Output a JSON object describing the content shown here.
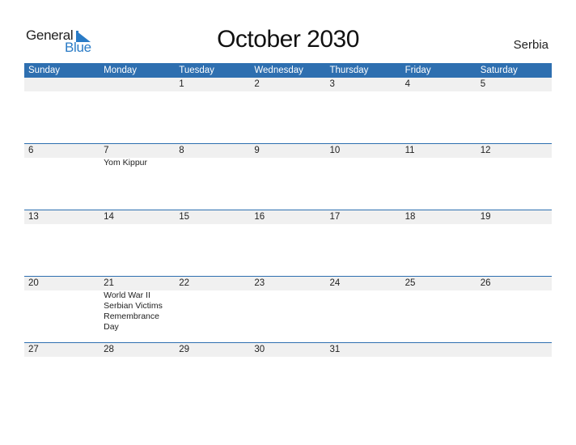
{
  "logo": {
    "word1": "General",
    "word2": "Blue",
    "icon": "blue-triangle-flag-icon"
  },
  "header": {
    "title": "October 2030",
    "country": "Serbia"
  },
  "colors": {
    "accent": "#2e6fb0",
    "logo_blue": "#2a7bc6",
    "strip": "#f0f0f0"
  },
  "days": [
    "Sunday",
    "Monday",
    "Tuesday",
    "Wednesday",
    "Thursday",
    "Friday",
    "Saturday"
  ],
  "weeks": [
    [
      {
        "day": ""
      },
      {
        "day": ""
      },
      {
        "day": "1"
      },
      {
        "day": "2"
      },
      {
        "day": "3"
      },
      {
        "day": "4"
      },
      {
        "day": "5"
      }
    ],
    [
      {
        "day": "6"
      },
      {
        "day": "7",
        "events": [
          "Yom Kippur"
        ]
      },
      {
        "day": "8"
      },
      {
        "day": "9"
      },
      {
        "day": "10"
      },
      {
        "day": "11"
      },
      {
        "day": "12"
      }
    ],
    [
      {
        "day": "13"
      },
      {
        "day": "14"
      },
      {
        "day": "15"
      },
      {
        "day": "16"
      },
      {
        "day": "17"
      },
      {
        "day": "18"
      },
      {
        "day": "19"
      }
    ],
    [
      {
        "day": "20"
      },
      {
        "day": "21",
        "events": [
          "World War II",
          "Serbian Victims",
          "Remembrance Day"
        ]
      },
      {
        "day": "22"
      },
      {
        "day": "23"
      },
      {
        "day": "24"
      },
      {
        "day": "25"
      },
      {
        "day": "26"
      }
    ],
    [
      {
        "day": "27"
      },
      {
        "day": "28"
      },
      {
        "day": "29"
      },
      {
        "day": "30"
      },
      {
        "day": "31"
      },
      {
        "day": ""
      },
      {
        "day": ""
      }
    ]
  ]
}
